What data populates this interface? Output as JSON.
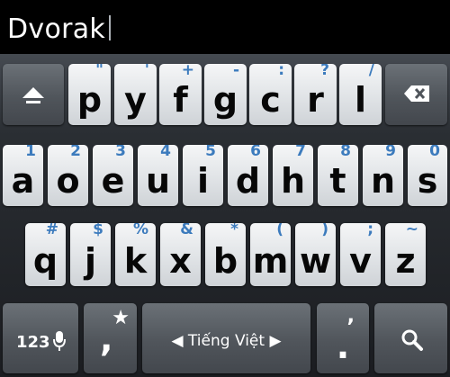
{
  "editor": {
    "text": "Dvorak"
  },
  "keyboard": {
    "row1": [
      {
        "main": "p",
        "hint": "\""
      },
      {
        "main": "y",
        "hint": "'"
      },
      {
        "main": "f",
        "hint": "+"
      },
      {
        "main": "g",
        "hint": "-"
      },
      {
        "main": "c",
        "hint": ":"
      },
      {
        "main": "r",
        "hint": "?"
      },
      {
        "main": "l",
        "hint": "/"
      }
    ],
    "row2": [
      {
        "main": "a",
        "hint": "1"
      },
      {
        "main": "o",
        "hint": "2"
      },
      {
        "main": "e",
        "hint": "3"
      },
      {
        "main": "u",
        "hint": "4"
      },
      {
        "main": "i",
        "hint": "5"
      },
      {
        "main": "d",
        "hint": "6"
      },
      {
        "main": "h",
        "hint": "7"
      },
      {
        "main": "t",
        "hint": "8"
      },
      {
        "main": "n",
        "hint": "9"
      },
      {
        "main": "s",
        "hint": "0"
      }
    ],
    "row3": [
      {
        "main": "q",
        "hint": "#"
      },
      {
        "main": "j",
        "hint": "$"
      },
      {
        "main": "k",
        "hint": "%"
      },
      {
        "main": "x",
        "hint": "&"
      },
      {
        "main": "b",
        "hint": "*"
      },
      {
        "main": "m",
        "hint": "("
      },
      {
        "main": "w",
        "hint": ")"
      },
      {
        "main": "v",
        "hint": ";"
      },
      {
        "main": "z",
        "hint": "~"
      }
    ],
    "bottom": {
      "symbols_label": "123",
      "comma_main": ",",
      "comma_hint": "★",
      "space_label": "◀ Tiếng Việt ▶",
      "period_main": ".",
      "period_hint": ","
    },
    "icons": {
      "shift": "shift-icon",
      "backspace": "backspace-icon",
      "mic": "microphone-icon",
      "search": "search-icon"
    },
    "colors": {
      "hint": "#3c7bbd",
      "light_key": "#e2e5e8",
      "dark_key": "#50555b"
    }
  }
}
